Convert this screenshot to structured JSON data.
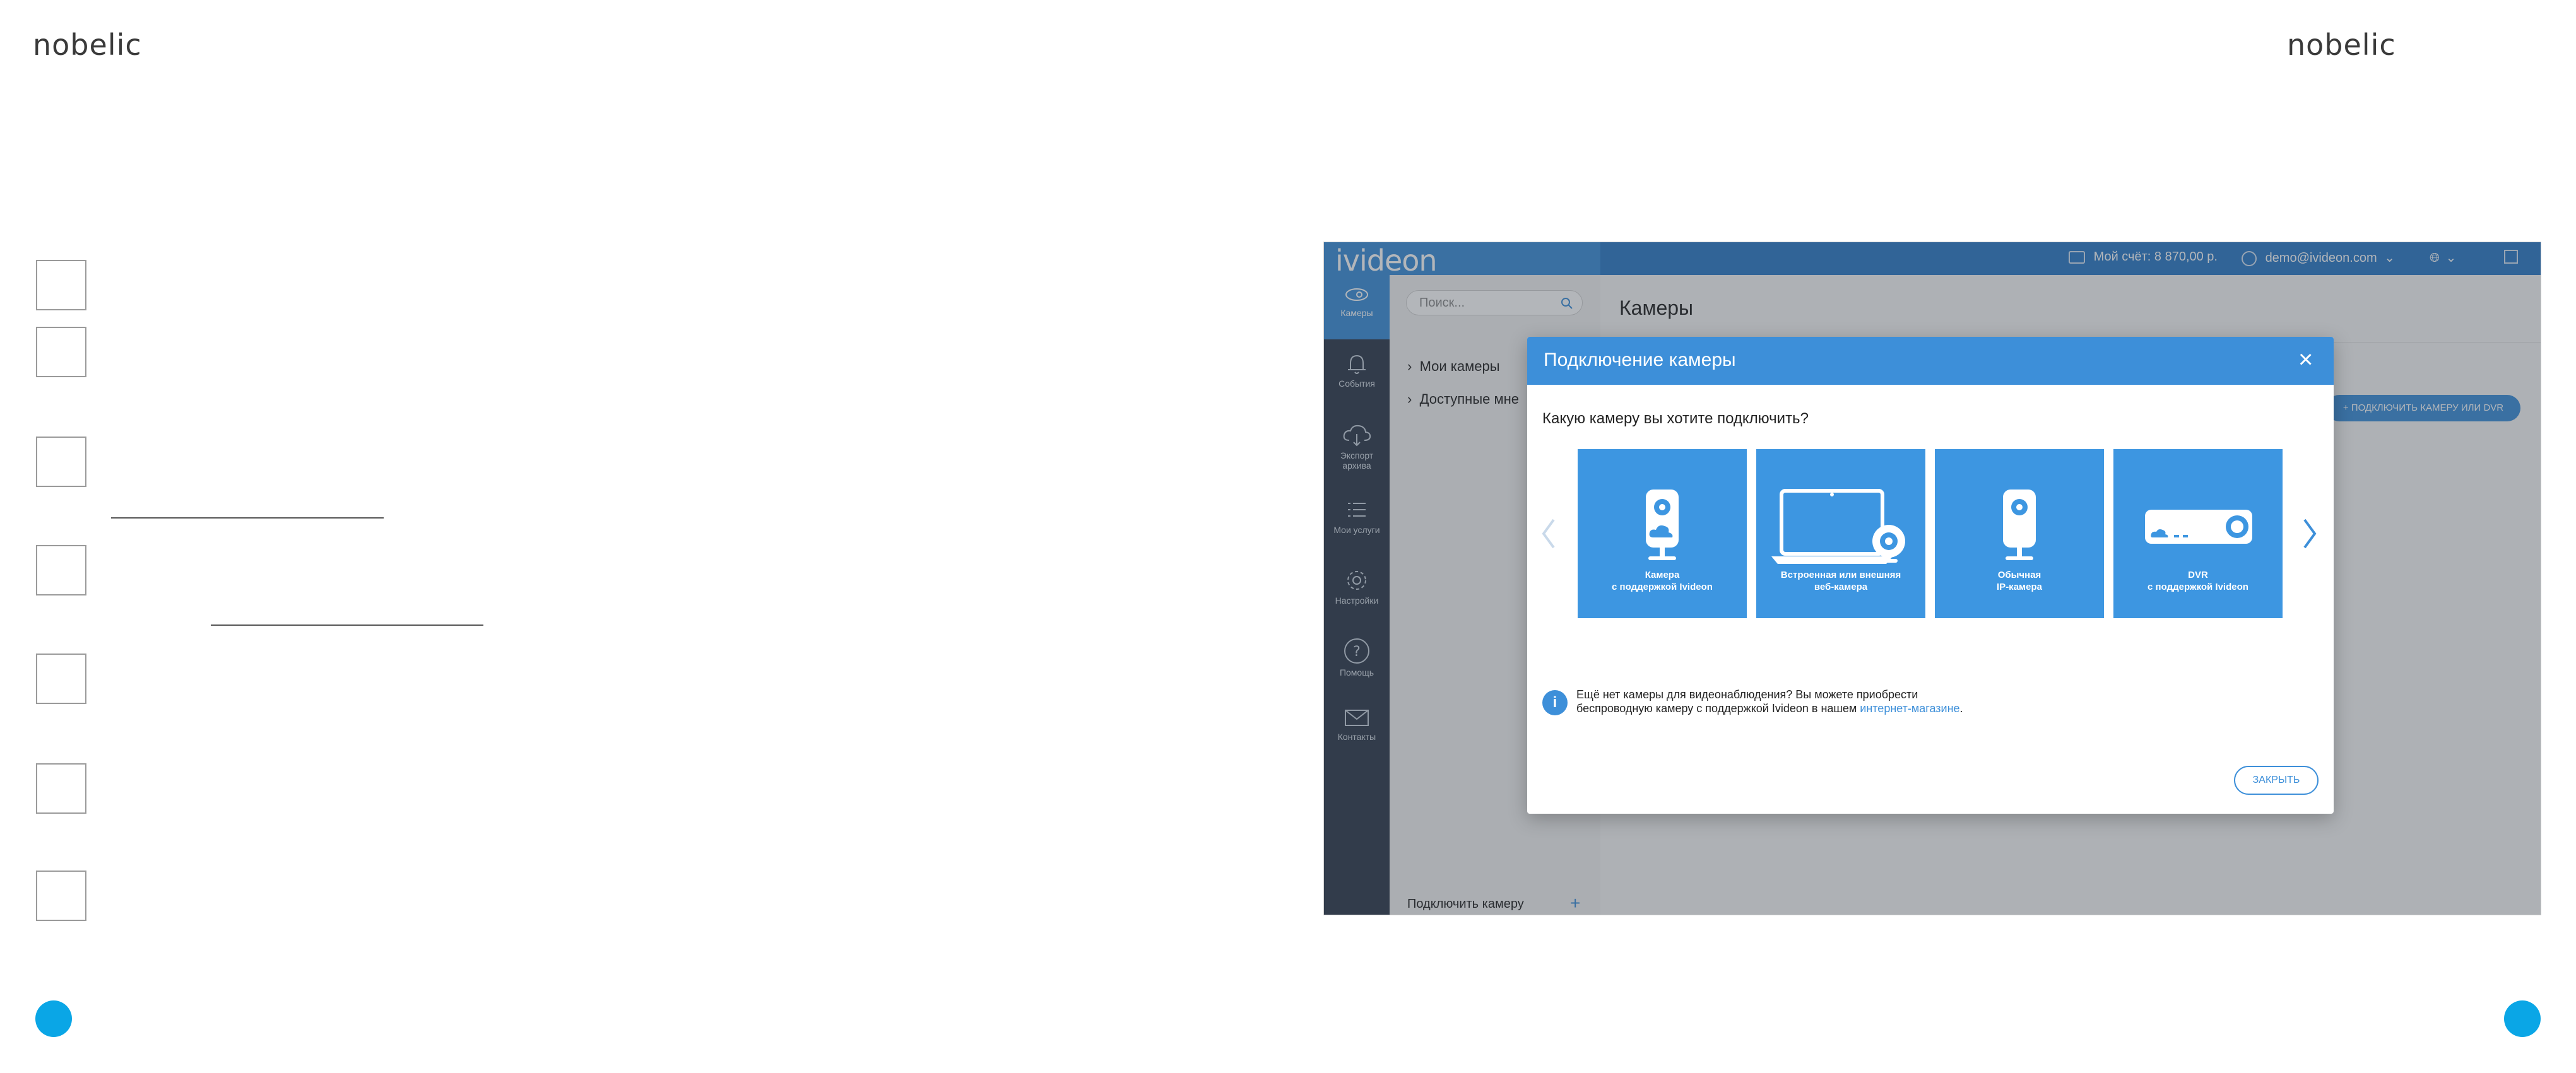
{
  "page": {
    "brand_left": "nobelic",
    "brand_right": "nobelic",
    "accent_color": "#0aa6e6"
  },
  "app": {
    "logo": "ivideon",
    "account": "Мой счёт: 8 870,00 р.",
    "user": "demo@ivideon.com",
    "brand_color": "#3d8fd9"
  },
  "sidebar": {
    "items": [
      {
        "label": "Камеры",
        "icon": "camera-icon"
      },
      {
        "label": "События",
        "icon": "bell-icon"
      },
      {
        "label": "Экспорт архива",
        "icon": "cloud-icon"
      },
      {
        "label": "Мои услуги",
        "icon": "list-icon"
      },
      {
        "label": "Настройки",
        "icon": "gear-icon"
      },
      {
        "label": "Помощь",
        "icon": "help-icon"
      },
      {
        "label": "Контакты",
        "icon": "mail-icon"
      }
    ]
  },
  "leftpanel": {
    "search_placeholder": "Поиск...",
    "tree": [
      "Мои камеры",
      "Доступные мне"
    ],
    "connect": "Подключить камеру"
  },
  "main": {
    "title": "Камеры",
    "connect_button": "+ ПОДКЛЮЧИТЬ КАМЕРУ ИЛИ DVR"
  },
  "modal": {
    "title": "Подключение камеры",
    "question": "Какую камеру вы хотите подключить?",
    "tiles": [
      {
        "line1": "Камера",
        "line2": "с поддержкой Ivideon",
        "icon": "cloud-camera-icon"
      },
      {
        "line1": "Встроенная или внешняя",
        "line2": "веб-камера",
        "icon": "webcam-icon"
      },
      {
        "line1": "Обычная",
        "line2": "IP-камера",
        "icon": "ip-camera-icon"
      },
      {
        "line1": "DVR",
        "line2": "с поддержкой Ivideon",
        "icon": "dvr-icon"
      }
    ],
    "info_line1": "Ещё нет камеры для видеонаблюдения? Вы можете приобрести",
    "info_line2": "беспроводную камеру с поддержкой Ivideon в нашем",
    "info_link": "интернет-магазине",
    "info_end": ".",
    "close_button": "ЗАКРЫТЬ"
  }
}
